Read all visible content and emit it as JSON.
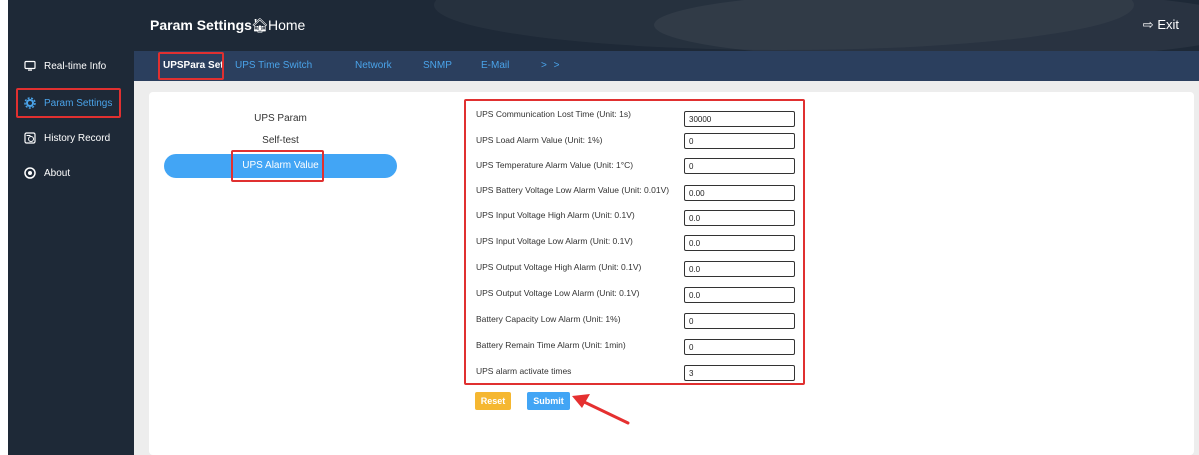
{
  "header": {
    "title": "Param Settings",
    "home_label": "Home",
    "exit_label": "Exit"
  },
  "sidebar": {
    "items": [
      {
        "label": "Real-time Info",
        "icon": "monitor-icon"
      },
      {
        "label": "Param Settings",
        "icon": "gear-icon"
      },
      {
        "label": "History Record",
        "icon": "history-icon"
      },
      {
        "label": "About",
        "icon": "about-icon"
      }
    ]
  },
  "tabs": [
    {
      "label": "UPSPara Set"
    },
    {
      "label": "UPS Time Switch"
    },
    {
      "label": "Network"
    },
    {
      "label": "SNMP"
    },
    {
      "label": "E-Mail"
    },
    {
      "label": "> >"
    }
  ],
  "menu": {
    "items": [
      {
        "label": "UPS Param"
      },
      {
        "label": "Self-test"
      },
      {
        "label": "UPS Alarm Value"
      }
    ]
  },
  "form": {
    "fields": [
      {
        "label": "UPS Communication Lost Time (Unit: 1s)",
        "value": "30000"
      },
      {
        "label": "UPS Load Alarm Value (Unit: 1%)",
        "value": "0"
      },
      {
        "label": "UPS Temperature Alarm Value (Unit: 1°C)",
        "value": "0"
      },
      {
        "label": "UPS Battery Voltage Low Alarm Value (Unit: 0.01V)",
        "value": "0.00"
      },
      {
        "label": "UPS Input Voltage High Alarm (Unit: 0.1V)",
        "value": "0.0"
      },
      {
        "label": "UPS Input Voltage Low Alarm (Unit: 0.1V)",
        "value": "0.0"
      },
      {
        "label": "UPS Output Voltage High Alarm (Unit: 0.1V)",
        "value": "0.0"
      },
      {
        "label": "UPS Output Voltage Low Alarm (Unit: 0.1V)",
        "value": "0.0"
      },
      {
        "label": "Battery Capacity Low Alarm (Unit: 1%)",
        "value": "0"
      },
      {
        "label": "Battery Remain Time Alarm (Unit: 1min)",
        "value": "0"
      },
      {
        "label": "UPS alarm activate times",
        "value": "3"
      }
    ],
    "reset_label": "Reset",
    "submit_label": "Submit"
  },
  "colors": {
    "sidebar_bg": "#1e2937",
    "tabbar_bg": "#2b3f5e",
    "accent": "#42a5f5",
    "highlight_box": "#e03030",
    "reset_button": "#f5b731"
  }
}
